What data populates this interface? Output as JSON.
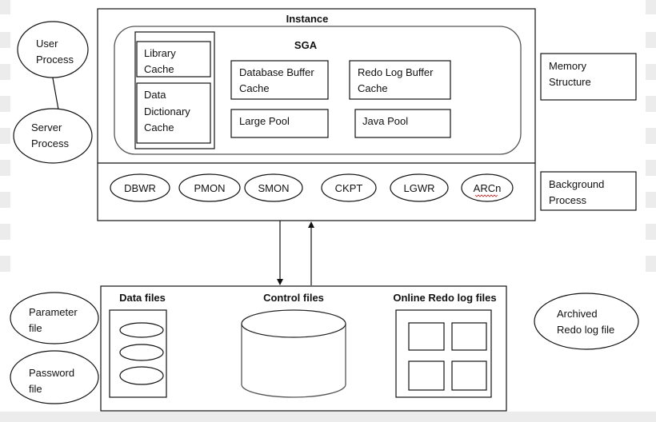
{
  "instance": {
    "title": "Instance",
    "sga": {
      "title": "SGA",
      "library_cache": [
        "Library",
        "Cache"
      ],
      "data_dictionary_cache": [
        "Data",
        "Dictionary",
        "Cache"
      ],
      "database_buffer_cache": [
        "Database Buffer",
        "Cache"
      ],
      "redo_log_buffer_cache": [
        "Redo Log Buffer",
        "Cache"
      ],
      "large_pool": "Large Pool",
      "java_pool": "Java Pool"
    },
    "background_processes": [
      "DBWR",
      "PMON",
      "SMON",
      "CKPT",
      "LGWR",
      "ARCn"
    ]
  },
  "side_labels": {
    "memory_structure": [
      "Memory",
      "Structure"
    ],
    "background_process": [
      "Background",
      "Process"
    ]
  },
  "processes": {
    "user_process": [
      "User",
      "Process"
    ],
    "server_process": [
      "Server",
      "Process"
    ]
  },
  "database": {
    "data_files": "Data files",
    "control_files": "Control files",
    "online_redo_log_files": "Online Redo log files"
  },
  "external_files": {
    "parameter_file": [
      "Parameter",
      "file"
    ],
    "password_file": [
      "Password",
      "file"
    ],
    "archived_redo_log_file": [
      "Archived",
      "Redo log file"
    ]
  }
}
